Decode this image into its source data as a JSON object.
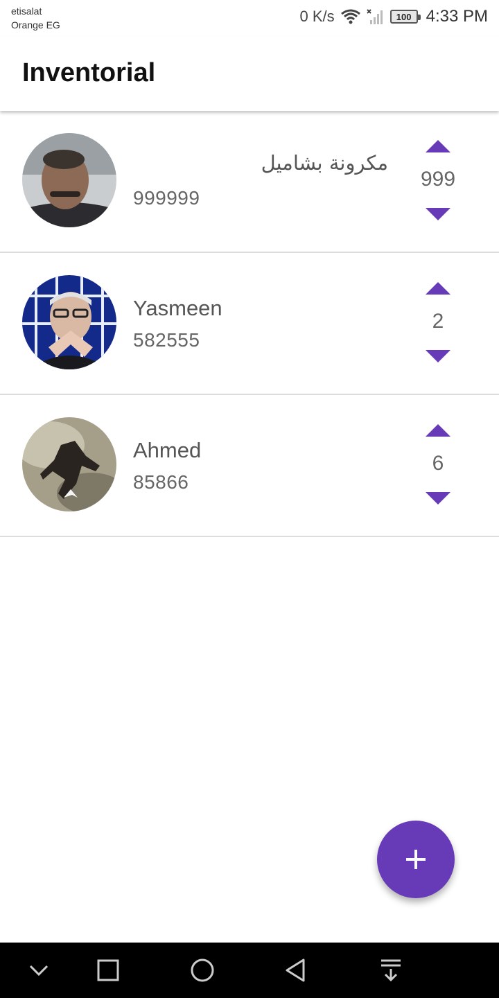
{
  "status_bar": {
    "carrier_line1": "etisalat",
    "carrier_line2": "Orange EG",
    "net_speed": "0 K/s",
    "battery": "100",
    "time": "4:33 PM",
    "icons": [
      "wifi-icon",
      "signal-icon"
    ]
  },
  "app_bar": {
    "title": "Inventorial"
  },
  "items": [
    {
      "name": "مكرونة بشاميل",
      "price": "999999",
      "quantity": "999",
      "avatar": "man-in-suit-photo"
    },
    {
      "name": "Yasmeen",
      "price": "582555",
      "quantity": "2",
      "avatar": "man-with-glasses-photo"
    },
    {
      "name": "Ahmed",
      "price": "85866",
      "quantity": "6",
      "avatar": "game-character-photo"
    }
  ],
  "fab": {
    "icon": "plus-icon"
  },
  "nav_bar": {
    "icons": [
      "chevron-down-icon",
      "recents-icon",
      "home-icon",
      "back-icon",
      "notifications-pull-icon"
    ]
  },
  "colors": {
    "accent": "#673ab7",
    "text_primary": "#111111",
    "text_secondary": "#666666",
    "divider": "#dcdcdc"
  }
}
